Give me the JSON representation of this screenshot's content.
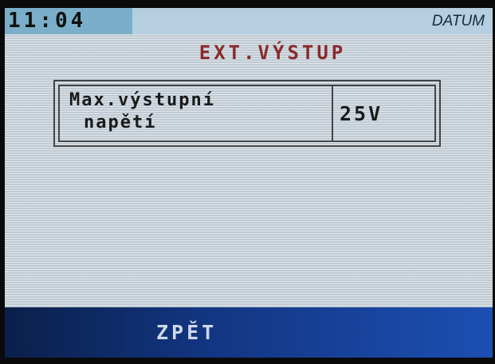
{
  "status_bar": {
    "time": "11:04",
    "date_label": "DATUM"
  },
  "screen": {
    "title": "EXT.VÝSTUP"
  },
  "parameter": {
    "label_line1": "Max.výstupní",
    "label_line2": "napětí",
    "value": "25V"
  },
  "bottom_bar": {
    "back_label": "ZPĚT"
  },
  "colors": {
    "screen_bg": "#cfd8e0",
    "clock_bg": "#7aaec9",
    "title_color": "#8a2a2a",
    "bottom_bar": "#123580"
  }
}
